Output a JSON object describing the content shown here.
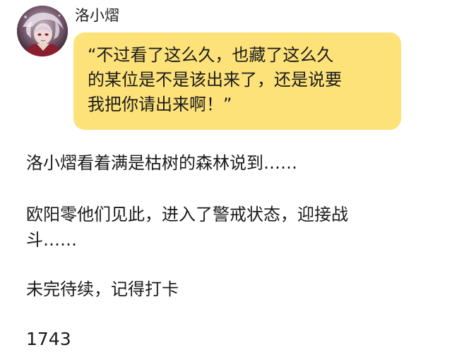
{
  "message": {
    "speaker_name": "洛小熠",
    "bubble_lines": [
      "“不过看了这么久，也藏了这么久",
      "的某位是不是该出来了，还是说要",
      "我把你请出来啊！”"
    ],
    "bubble_color": "#fde27a",
    "avatar_icon": "anime-character-avatar"
  },
  "paragraphs": [
    "洛小熠看着满是枯树的森林说到……",
    "欧阳零他们见此，进入了警戒状态，迎接战",
    "斗……",
    "未完待续，记得打卡",
    "1743"
  ]
}
